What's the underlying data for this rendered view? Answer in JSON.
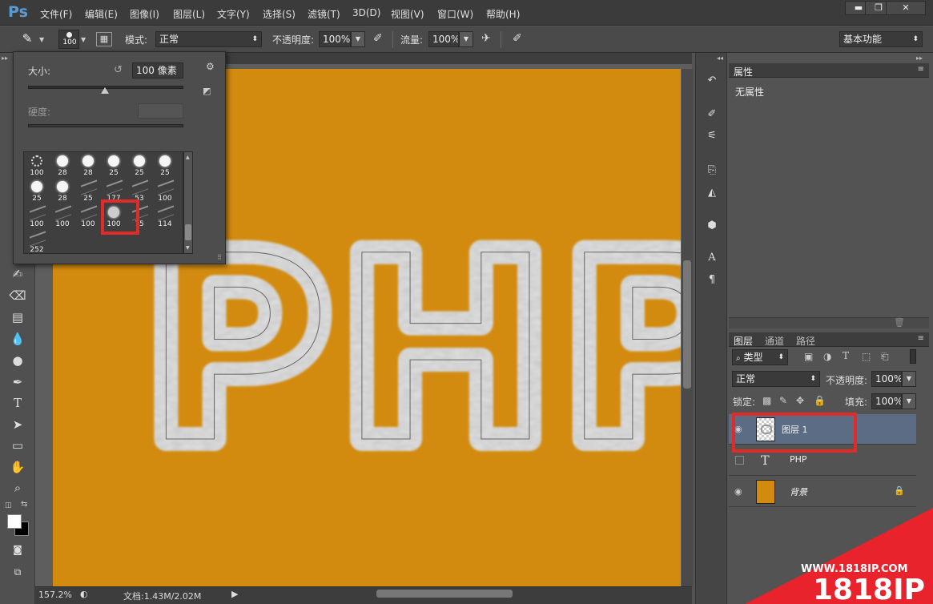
{
  "app": {
    "logo": "Ps"
  },
  "menu": [
    "文件(F)",
    "编辑(E)",
    "图像(I)",
    "图层(L)",
    "文字(Y)",
    "选择(S)",
    "滤镜(T)",
    "3D(D)",
    "视图(V)",
    "窗口(W)",
    "帮助(H)"
  ],
  "window_controls": {
    "minimize": "▬",
    "restore": "❐",
    "close": "✕"
  },
  "options": {
    "brush_size": "100",
    "mode_label": "模式:",
    "mode_value": "正常",
    "opacity_label": "不透明度:",
    "opacity_value": "100%",
    "flow_label": "流量:",
    "flow_value": "100%",
    "workspace": "基本功能"
  },
  "brush_panel": {
    "size_label": "大小:",
    "size_value": "100 像素",
    "hardness_label": "硬度:",
    "presets": [
      {
        "kind": "star",
        "label": "100"
      },
      {
        "kind": "dot",
        "label": "28"
      },
      {
        "kind": "dot",
        "label": "28"
      },
      {
        "kind": "dot",
        "label": "25"
      },
      {
        "kind": "dot",
        "label": "25"
      },
      {
        "kind": "dot",
        "label": "25"
      },
      {
        "kind": "dot",
        "label": "25"
      },
      {
        "kind": "dot",
        "label": "28"
      },
      {
        "kind": "stroke",
        "label": "25"
      },
      {
        "kind": "stroke",
        "label": "177"
      },
      {
        "kind": "stroke",
        "label": "53"
      },
      {
        "kind": "stroke",
        "label": "100"
      },
      {
        "kind": "stroke",
        "label": "100"
      },
      {
        "kind": "stroke",
        "label": "100"
      },
      {
        "kind": "stroke",
        "label": "100"
      },
      {
        "kind": "fur",
        "label": "100"
      },
      {
        "kind": "stroke",
        "label": "75"
      },
      {
        "kind": "stroke",
        "label": "114"
      },
      {
        "kind": "stroke",
        "label": "252"
      }
    ]
  },
  "document": {
    "canvas_color": "#d28b0f",
    "text": "PHP"
  },
  "status": {
    "zoom": "157.2%",
    "doc": "文档:1.43M/2.02M"
  },
  "properties": {
    "tab": "属性",
    "content": "无属性"
  },
  "layers_panel": {
    "tabs": [
      "图层",
      "通道",
      "路径"
    ],
    "filter": "类型",
    "blend": "正常",
    "opacity_label": "不透明度:",
    "opacity_value": "100%",
    "lock_label": "锁定:",
    "fill_label": "填充:",
    "fill_value": "100%",
    "layers": [
      {
        "name": "图层 1",
        "visible": true,
        "selected": true
      },
      {
        "name": "PHP",
        "visible": false,
        "selected": false
      },
      {
        "name": "背景",
        "visible": true,
        "selected": false
      }
    ]
  },
  "watermark": {
    "url": "WWW.1818IP.COM",
    "brand": "1818IP"
  }
}
